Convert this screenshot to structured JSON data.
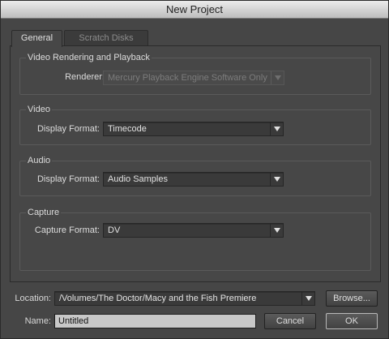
{
  "window": {
    "title": "New Project"
  },
  "tabs": [
    {
      "label": "General",
      "active": true
    },
    {
      "label": "Scratch Disks",
      "active": false
    }
  ],
  "sections": {
    "video_rendering": {
      "title": "Video Rendering and Playback",
      "renderer_label": "Renderer:",
      "renderer_value": "Mercury Playback Engine Software Only"
    },
    "video": {
      "title": "Video",
      "display_format_label": "Display Format:",
      "display_format_value": "Timecode"
    },
    "audio": {
      "title": "Audio",
      "display_format_label": "Display Format:",
      "display_format_value": "Audio Samples"
    },
    "capture": {
      "title": "Capture",
      "capture_format_label": "Capture Format:",
      "capture_format_value": "DV"
    }
  },
  "footer": {
    "location_label": "Location:",
    "location_value": "/Volumes/The Doctor/Macy and the Fish Premiere",
    "browse_label": "Browse...",
    "name_label": "Name:",
    "name_value": "Untitled",
    "cancel_label": "Cancel",
    "ok_label": "OK"
  },
  "icons": {
    "dropdown": "chevron-down-icon"
  }
}
